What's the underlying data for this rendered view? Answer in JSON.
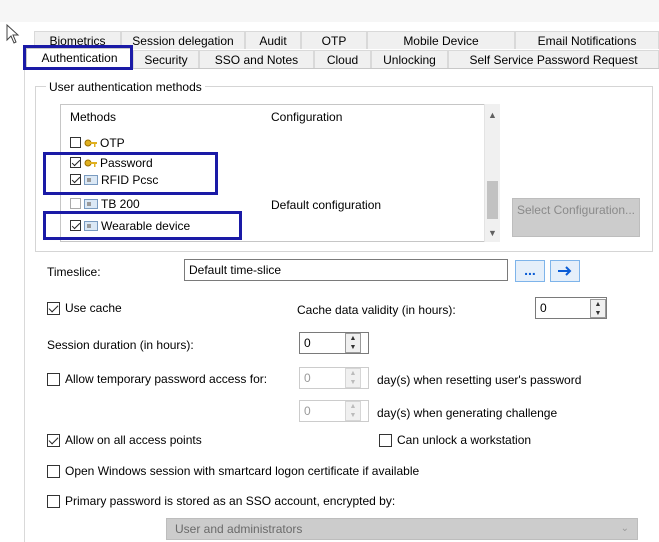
{
  "tabs_row1": [
    "Biometrics",
    "Session delegation",
    "Audit",
    "OTP",
    "Mobile Device",
    "Email Notifications"
  ],
  "tabs_row2": [
    "Authentication",
    "Security",
    "SSO and Notes",
    "Cloud",
    "Unlocking",
    "Self Service Password Request"
  ],
  "active_tab": "Authentication",
  "group_title": "User authentication methods",
  "list": {
    "col_methods": "Methods",
    "col_config": "Configuration",
    "items": [
      {
        "label": "OTP",
        "checked": false,
        "icon": "key-icon",
        "config": ""
      },
      {
        "label": "Password",
        "checked": true,
        "icon": "key-icon",
        "config": ""
      },
      {
        "label": "RFID Pcsc",
        "checked": true,
        "icon": "card-icon",
        "config": ""
      },
      {
        "label": "TB 200",
        "checked": false,
        "icon": "card-icon",
        "config": "Default configuration"
      },
      {
        "label": "Wearable device",
        "checked": true,
        "icon": "card-icon",
        "config": ""
      }
    ]
  },
  "select_config_label": "Select Configuration...",
  "timeslice": {
    "label": "Timeslice:",
    "value": "Default time-slice",
    "browse_label": "...",
    "go_icon": "arrow-right-icon"
  },
  "use_cache": {
    "label": "Use cache",
    "checked": true
  },
  "cache_validity": {
    "label": "Cache data validity (in hours):",
    "value": "0"
  },
  "session_duration": {
    "label": "Session duration (in hours):",
    "value": "0"
  },
  "temp_password": {
    "label": "Allow temporary password access for:",
    "checked": false,
    "value1": "0",
    "suffix1": "day(s) when resetting user's password",
    "value2": "0",
    "suffix2": "day(s) when generating challenge"
  },
  "allow_all_access": {
    "label": "Allow on all access points",
    "checked": true
  },
  "can_unlock": {
    "label": "Can unlock a workstation",
    "checked": false
  },
  "open_windows": {
    "label": "Open Windows session with smartcard logon certificate if available",
    "checked": false
  },
  "primary_password": {
    "label": "Primary password is stored as an SSO account, encrypted by:",
    "checked": false
  },
  "encrypted_by": {
    "value": "User and administrators"
  },
  "colors": {
    "highlight": "#1a1aa6",
    "accent": "#0a5cd6"
  }
}
